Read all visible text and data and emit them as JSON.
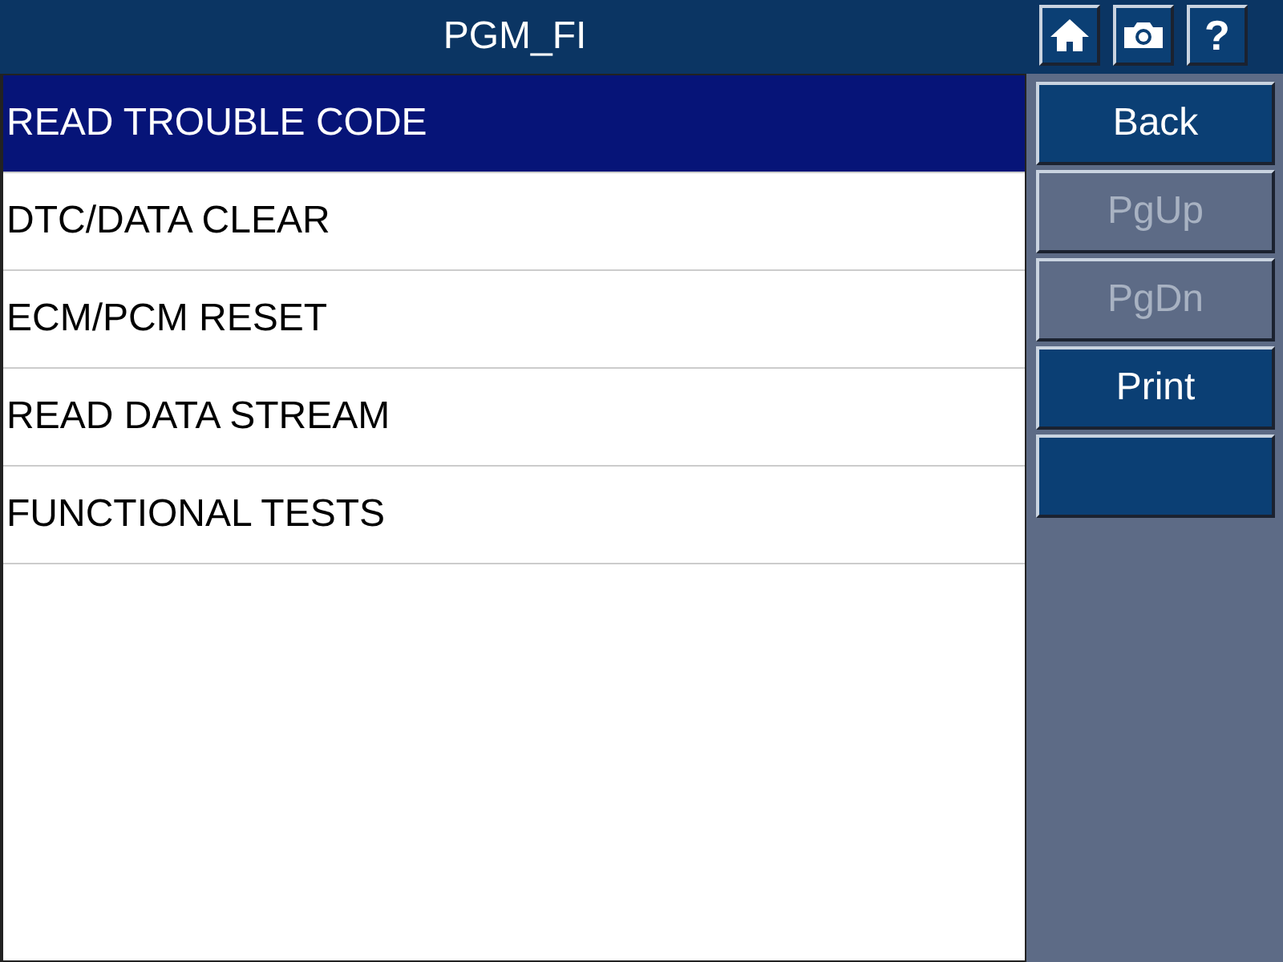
{
  "window": {
    "title": "PGM_FI"
  },
  "menu": [
    {
      "label": "READ TROUBLE CODE",
      "selected": true
    },
    {
      "label": "DTC/DATA CLEAR",
      "selected": false
    },
    {
      "label": "ECM/PCM RESET",
      "selected": false
    },
    {
      "label": "READ DATA STREAM",
      "selected": false
    },
    {
      "label": "FUNCTIONAL TESTS",
      "selected": false
    }
  ],
  "toolbar": [
    {
      "kind": "home"
    },
    {
      "kind": "camera"
    },
    {
      "kind": "help",
      "label": "?"
    }
  ],
  "buttons": [
    {
      "kind": "text",
      "label": "Back",
      "disabled": false
    },
    {
      "kind": "text",
      "label": "PgUp",
      "disabled": true
    },
    {
      "kind": "text",
      "label": "PgDn",
      "disabled": true
    },
    {
      "kind": "text",
      "label": "Print",
      "disabled": false
    },
    {
      "kind": "blank",
      "disabled": false
    }
  ]
}
